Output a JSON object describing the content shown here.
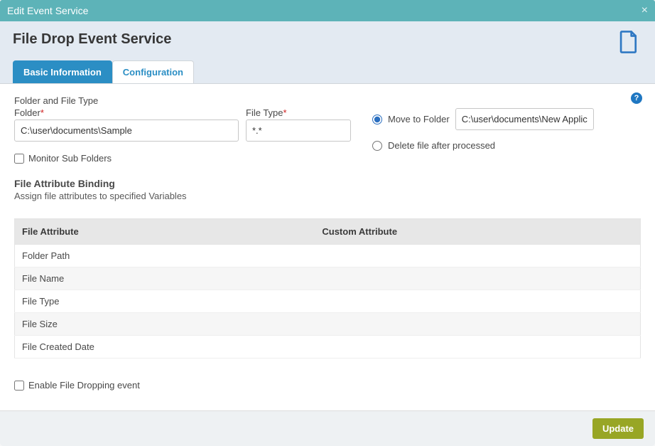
{
  "dialog": {
    "title": "Edit Event Service",
    "close_glyph": "×"
  },
  "header": {
    "title": "File Drop Event Service"
  },
  "tabs": [
    {
      "label": "Basic Information"
    },
    {
      "label": "Configuration"
    }
  ],
  "help": {
    "glyph": "?"
  },
  "section": {
    "group_label": "Folder and File Type",
    "folder_label": "Folder",
    "folder_value": "C:\\user\\documents\\Sample",
    "filetype_label": "File Type",
    "filetype_value": "*.*",
    "monitor_sub_label": "Monitor Sub Folders"
  },
  "processing": {
    "move_label": "Move to Folder",
    "move_value": "C:\\user\\documents\\New Applica",
    "delete_label": "Delete file after processed"
  },
  "binding": {
    "title": "File Attribute Binding",
    "subtitle": "Assign file attributes to specified Variables"
  },
  "table": {
    "headers": {
      "col1": "File Attribute",
      "col2": "Custom Attribute"
    },
    "rows": [
      {
        "attr": "Folder Path",
        "custom": ""
      },
      {
        "attr": "File Name",
        "custom": ""
      },
      {
        "attr": "File Type",
        "custom": ""
      },
      {
        "attr": "File Size",
        "custom": ""
      },
      {
        "attr": "File Created Date",
        "custom": ""
      }
    ]
  },
  "enable_drop": {
    "label": "Enable File Dropping event"
  },
  "footer": {
    "update_label": "Update"
  }
}
